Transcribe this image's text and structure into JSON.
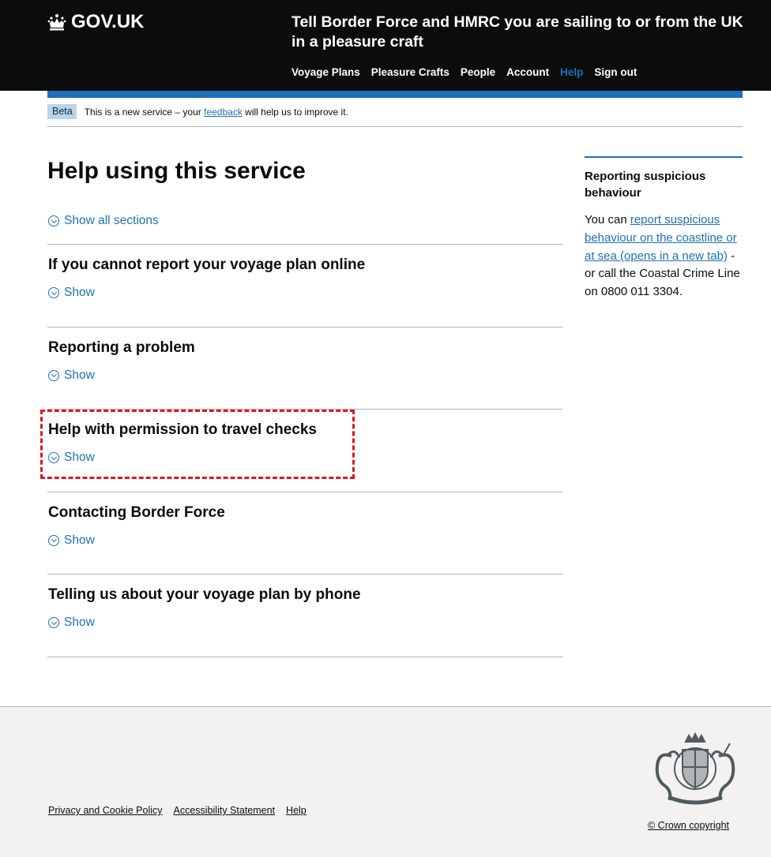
{
  "header": {
    "logo_text": "GOV.UK",
    "service_name": "Tell Border Force and HMRC you are sailing to or from the UK in a pleasure craft",
    "nav": [
      {
        "label": "Voyage Plans",
        "active": false
      },
      {
        "label": "Pleasure Crafts",
        "active": false
      },
      {
        "label": "People",
        "active": false
      },
      {
        "label": "Account",
        "active": false
      },
      {
        "label": "Help",
        "active": true
      },
      {
        "label": "Sign out",
        "active": false
      }
    ]
  },
  "phase_banner": {
    "tag": "Beta",
    "text_before": "This is a new service – your ",
    "link": "feedback",
    "text_after": " will help us to improve it."
  },
  "main": {
    "title": "Help using this service",
    "show_all": "Show all sections",
    "sections": [
      {
        "heading": "If you cannot report your voyage plan online",
        "toggle": "Show"
      },
      {
        "heading": "Reporting a problem",
        "toggle": "Show"
      },
      {
        "heading": "Help with permission to travel checks",
        "toggle": "Show"
      },
      {
        "heading": "Contacting Border Force",
        "toggle": "Show"
      },
      {
        "heading": "Telling us about your voyage plan by phone",
        "toggle": "Show"
      }
    ]
  },
  "sidebar": {
    "heading": "Reporting suspicious behaviour",
    "text_before": "You can ",
    "link": "report suspicious behaviour on the coastline or at sea (opens in a new tab)",
    "text_after": " - or call the Coastal Crime Line on 0800 011 3304."
  },
  "footer": {
    "links": [
      "Privacy and Cookie Policy",
      "Accessibility Statement",
      "Help"
    ],
    "copyright": "© Crown copyright"
  },
  "colors": {
    "header_bg": "#0b0c0c",
    "link": "#1d70b8",
    "highlight": "#e1141e",
    "footer_bg": "#f3f2f1"
  }
}
